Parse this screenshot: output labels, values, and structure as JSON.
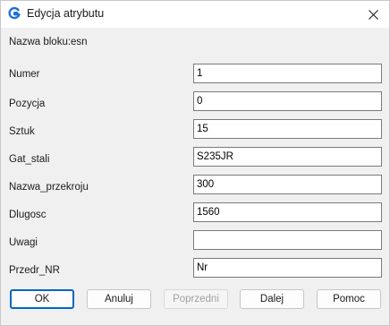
{
  "window": {
    "title": "Edycja atrybutu"
  },
  "block_name": "Nazwa bloku:esn",
  "fields": [
    {
      "label": "Numer",
      "value": "1"
    },
    {
      "label": "Pozycja",
      "value": "0"
    },
    {
      "label": "Sztuk",
      "value": "15"
    },
    {
      "label": "Gat_stali",
      "value": "S235JR"
    },
    {
      "label": "Nazwa_przekroju",
      "value": "300"
    },
    {
      "label": "Dlugosc",
      "value": "1560"
    },
    {
      "label": "Uwagi",
      "value": ""
    },
    {
      "label": "Przedr_NR",
      "value": "Nr"
    }
  ],
  "buttons": {
    "ok": "OK",
    "cancel": "Anuluj",
    "previous": "Poprzedni",
    "next": "Dalej",
    "help": "Pomoc"
  },
  "colors": {
    "accent": "#0067c0",
    "app_icon": "#1e6fd9"
  }
}
